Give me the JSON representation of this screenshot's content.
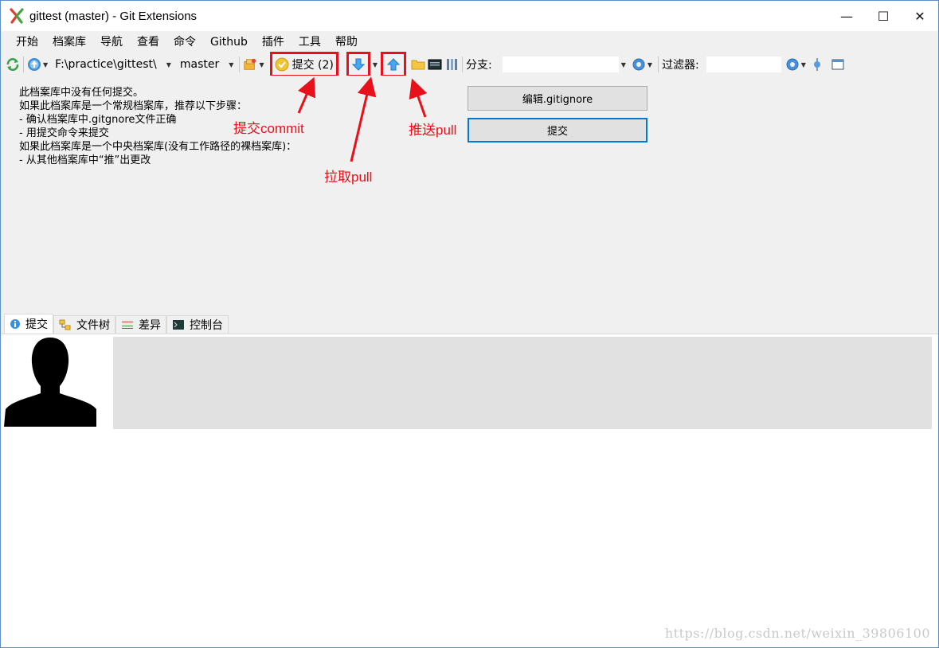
{
  "window": {
    "title": "gittest (master) - Git Extensions",
    "controls": {
      "minimize": "—",
      "maximize": "☐",
      "close": "✕"
    }
  },
  "menu": [
    "开始",
    "档案库",
    "导航",
    "查看",
    "命令",
    "Github",
    "插件",
    "工具",
    "帮助"
  ],
  "toolbar": {
    "path": "F:\\practice\\gittest\\",
    "branch": "master",
    "commit_label": "提交 (2)",
    "branch_label": "分支:",
    "branch_value": "",
    "filter_label": "过滤器:",
    "filter_value": ""
  },
  "info_lines": [
    "此档案库中没有任何提交。",
    "如果此档案库是一个常规档案库，推荐以下步骤：",
    "- 确认档案库中.gitgnore文件正确",
    "- 用提交命令来提交",
    "如果此档案库是一个中央档案库(没有工作路径的裸档案库)：",
    "- 从其他档案库中“推”出更改"
  ],
  "buttons": {
    "edit_gitignore": "编辑.gitignore",
    "commit": "提交"
  },
  "annotations": {
    "commit": "提交commit",
    "pull": "拉取pull",
    "push": "推送pull"
  },
  "tabs": [
    "提交",
    "文件树",
    "差异",
    "控制台"
  ],
  "watermark": "https://blog.csdn.net/weixin_39806100",
  "colors": {
    "annotation_red": "#e8101a",
    "toolbar_bg": "#f0f0f0",
    "focus_blue": "#0078d7"
  },
  "icons": {
    "refresh": "refresh-icon",
    "dashboard": "dashboard-icon",
    "commit": "commit-check-icon",
    "pull": "pull-arrow-down-icon",
    "push": "push-arrow-up-icon",
    "settings": "gear-icon"
  }
}
